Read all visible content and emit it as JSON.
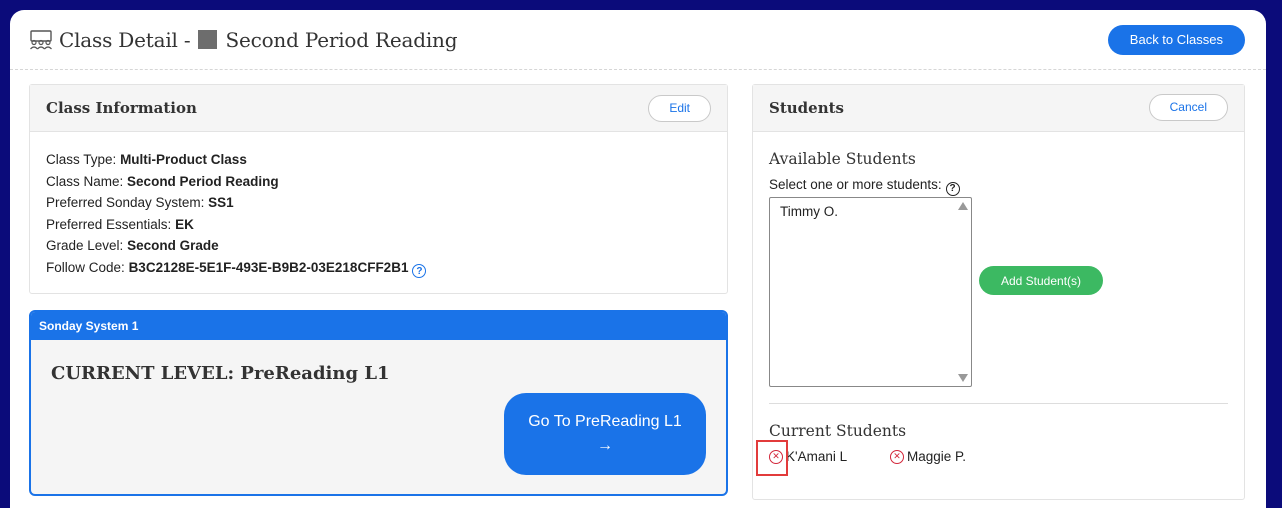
{
  "header": {
    "title_prefix": "Class Detail -",
    "title_name": "Second Period Reading",
    "back_button": "Back to Classes",
    "icon": "classroom-icon"
  },
  "class_info": {
    "title": "Class Information",
    "edit_button": "Edit",
    "fields": [
      {
        "label": "Class Type:",
        "value": "Multi-Product Class"
      },
      {
        "label": "Class Name:",
        "value": "Second Period Reading"
      },
      {
        "label": "Preferred Sonday System:",
        "value": "SS1"
      },
      {
        "label": "Preferred Essentials:",
        "value": "EK"
      },
      {
        "label": "Grade Level:",
        "value": "Second Grade"
      },
      {
        "label": "Follow Code:",
        "value": "B3C2128E-5E1F-493E-B9B2-03E218CFF2B1"
      }
    ],
    "help_glyph": "?"
  },
  "sonday": {
    "header": "Sonday System 1",
    "current_level": "CURRENT LEVEL: PreReading L1",
    "go_button": "Go To PreReading L1",
    "go_arrow": "→"
  },
  "students": {
    "title": "Students",
    "cancel_button": "Cancel",
    "available_title": "Available Students",
    "select_label": "Select one or more students:",
    "help_glyph": "?",
    "available": [
      "Timmy O."
    ],
    "add_button": "Add Student(s)",
    "current_title": "Current Students",
    "current": [
      "K'Amani L",
      "Maggie P."
    ],
    "remove_glyph": "✕"
  },
  "colors": {
    "accent": "#1a73e8",
    "success": "#3cb962",
    "danger": "#d3273b",
    "banner": "#0b0b7a"
  }
}
